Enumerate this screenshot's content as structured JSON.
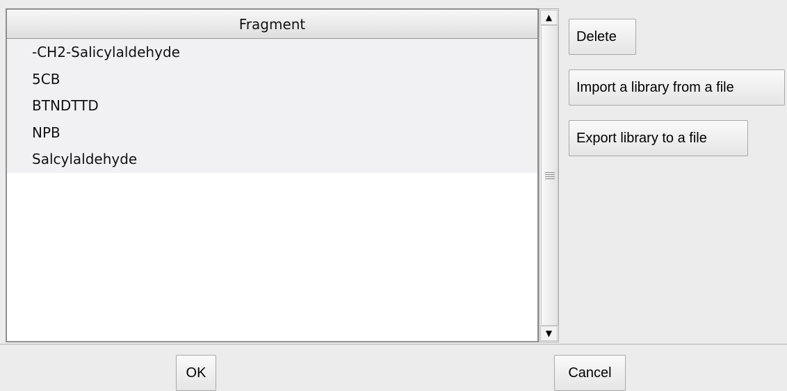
{
  "table": {
    "header": "Fragment",
    "rows": [
      "-CH2-Salicylaldehyde",
      "5CB",
      "BTNDTTD",
      "NPB",
      "Salcylaldehyde"
    ]
  },
  "actions": {
    "delete": "Delete",
    "import": "Import a library from a file",
    "export": "Export library to a file"
  },
  "footer": {
    "ok": "OK",
    "cancel": "Cancel"
  },
  "icons": {
    "scroll_up": "up-arrow-icon",
    "scroll_down": "down-arrow-icon",
    "scroll_grip": "grip-icon"
  }
}
